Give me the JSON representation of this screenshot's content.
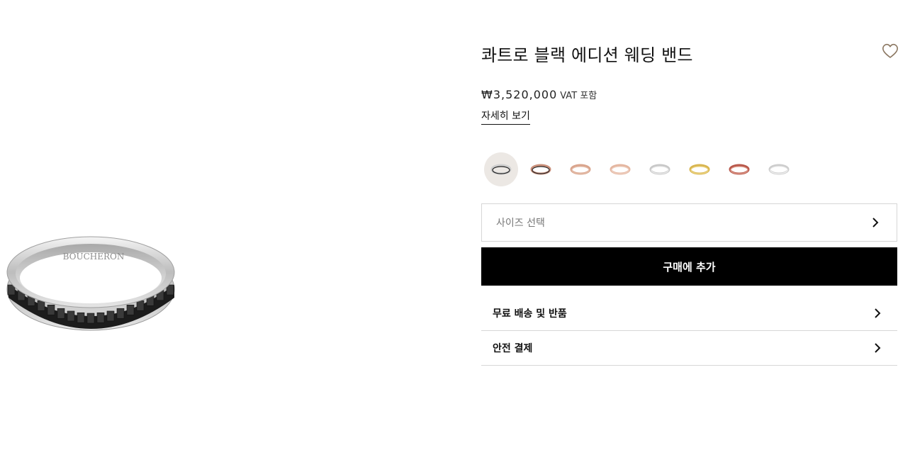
{
  "product": {
    "title": "콰트로 블랙 에디션 웨딩 밴드",
    "brand_engraving": "BOUCHERON",
    "price": "₩3,520,000",
    "vat_note": "VAT 포함",
    "details_link": "자세히 보기"
  },
  "icons": {
    "wishlist": "heart-outline-icon",
    "chevron": "chevron-right-icon"
  },
  "variants": [
    {
      "name": "white-gold-black-pvd",
      "metal": "#cfcfcf",
      "accent": "#222222",
      "selected": true
    },
    {
      "name": "pink-gold-black-pvd",
      "metal": "#c98f7a",
      "accent": "#2a2a2a",
      "selected": false
    },
    {
      "name": "pink-gold",
      "metal": "#d9a48c",
      "accent": "#e6c0ad",
      "selected": false
    },
    {
      "name": "pink-gold-slim",
      "metal": "#e4b6a0",
      "accent": "#f0d3c4",
      "selected": false
    },
    {
      "name": "white-gold",
      "metal": "#c8c8c8",
      "accent": "#ededed",
      "selected": false
    },
    {
      "name": "yellow-gold",
      "metal": "#d8b54f",
      "accent": "#efd88a",
      "selected": false
    },
    {
      "name": "pink-gold-mini",
      "metal": "#b8574a",
      "accent": "#e0a090",
      "selected": false
    },
    {
      "name": "white-gold-diamond",
      "metal": "#cdcdcd",
      "accent": "#f3f3f3",
      "selected": false
    }
  ],
  "size_select": {
    "placeholder": "사이즈 선택"
  },
  "add_to_cart": {
    "label": "구매에 추가"
  },
  "accordions": [
    {
      "label": "무료 배송 및 반품"
    },
    {
      "label": "안전 결제"
    }
  ],
  "colors": {
    "primary_button": "#000000",
    "border": "#d6d6d6",
    "selected_variant_bg": "#ece8e4",
    "wishlist_stroke": "#8a7660"
  }
}
